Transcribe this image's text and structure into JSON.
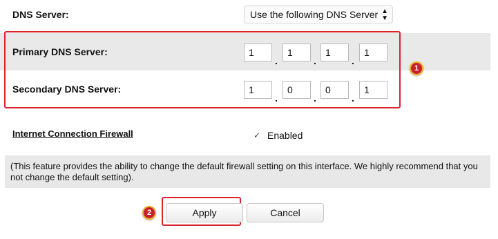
{
  "dns_server": {
    "label": "DNS Server:",
    "selected": "Use the following DNS Server"
  },
  "primary": {
    "label": "Primary DNS Server:",
    "octets": [
      "1",
      "1",
      "1",
      "1"
    ]
  },
  "secondary": {
    "label": "Secondary DNS Server:",
    "octets": [
      "1",
      "0",
      "0",
      "1"
    ]
  },
  "dot": ".",
  "badges": {
    "first": "1",
    "second": "2"
  },
  "firewall": {
    "label": "Internet Connection Firewall",
    "check_mark": "✓",
    "enabled_label": "Enabled"
  },
  "info": {
    "text": "(This feature provides the ability to change the default firewall setting on this interface. We highly recommend that you not change the default setting)."
  },
  "buttons": {
    "apply": "Apply",
    "cancel": "Cancel"
  },
  "colors": {
    "highlight": "#d9232d",
    "band": "#e9e9e9"
  }
}
